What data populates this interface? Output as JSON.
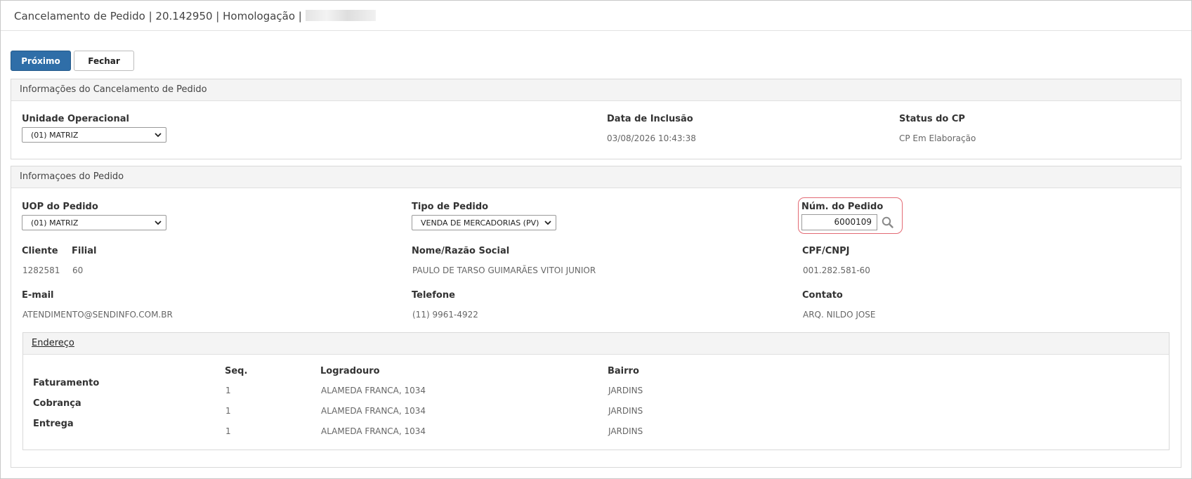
{
  "window": {
    "title": "Cancelamento de Pedido | 20.142950 | Homologação |"
  },
  "toolbar": {
    "next_label": "Próximo",
    "close_label": "Fechar"
  },
  "cancel_info": {
    "heading": "Informações do Cancelamento de Pedido",
    "unit_label": "Unidade Operacional",
    "unit_value": "(01) MATRIZ",
    "date_label": "Data de Inclusão",
    "date_value": "03/08/2026 10:43:38",
    "status_label": "Status do CP",
    "status_value": "CP Em Elaboração"
  },
  "order_info": {
    "heading": "Informaçoes do Pedido",
    "uop_label": "UOP do Pedido",
    "uop_value": "(01) MATRIZ",
    "type_label": "Tipo de Pedido",
    "type_value": "VENDA DE MERCADORIAS (PV)",
    "num_label": "Núm. do Pedido",
    "num_value": "6000109",
    "client_label": "Cliente",
    "client_value": "1282581",
    "branch_label": "Filial",
    "branch_value": "60",
    "name_label": "Nome/Razão Social",
    "name_value": "PAULO DE TARSO GUIMARÃES VITOI JUNIOR",
    "doc_label": "CPF/CNPJ",
    "doc_value": "001.282.581-60",
    "email_label": "E-mail",
    "email_value": "ATENDIMENTO@SENDINFO.COM.BR",
    "phone_label": "Telefone",
    "phone_value": "(11) 9961-4922",
    "contact_label": "Contato",
    "contact_value": "ARQ. NILDO JOSE"
  },
  "address": {
    "heading": "Endereço",
    "columns": [
      "Seq.",
      "Logradouro",
      "Bairro"
    ],
    "rows": [
      {
        "type": "Faturamento",
        "seq": "1",
        "street": "ALAMEDA FRANCA, 1034",
        "district": "JARDINS"
      },
      {
        "type": "Cobrança",
        "seq": "1",
        "street": "ALAMEDA FRANCA, 1034",
        "district": "JARDINS"
      },
      {
        "type": "Entrega",
        "seq": "1",
        "street": "ALAMEDA FRANCA, 1034",
        "district": "JARDINS"
      }
    ]
  },
  "colors": {
    "primary": "#2f6ea8",
    "highlight": "#e36a74"
  }
}
